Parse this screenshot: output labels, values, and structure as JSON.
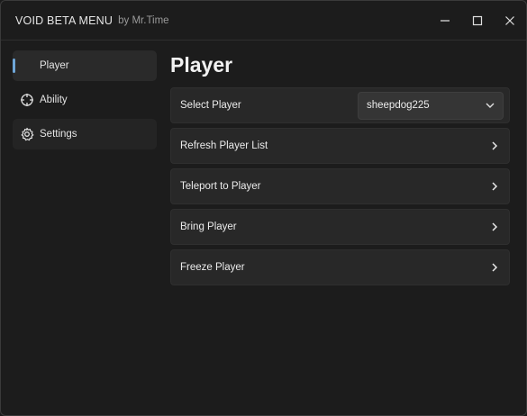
{
  "window": {
    "title": "VOID BETA MENU",
    "subtitle": "by Mr.Time"
  },
  "sidebar": {
    "items": [
      {
        "label": "Player",
        "icon": "none",
        "active": true
      },
      {
        "label": "Ability",
        "icon": "crosshair-icon",
        "active": false
      },
      {
        "label": "Settings",
        "icon": "gear-icon",
        "active": false
      }
    ]
  },
  "main": {
    "title": "Player",
    "select_player": {
      "label": "Select Player",
      "value": "sheepdog225"
    },
    "actions": [
      {
        "label": "Refresh Player List"
      },
      {
        "label": "Teleport to Player"
      },
      {
        "label": "Bring Player"
      },
      {
        "label": "Freeze Player"
      }
    ]
  },
  "colors": {
    "background": "#1c1c1c",
    "row": "#282828",
    "accent": "#6ea6d8"
  }
}
